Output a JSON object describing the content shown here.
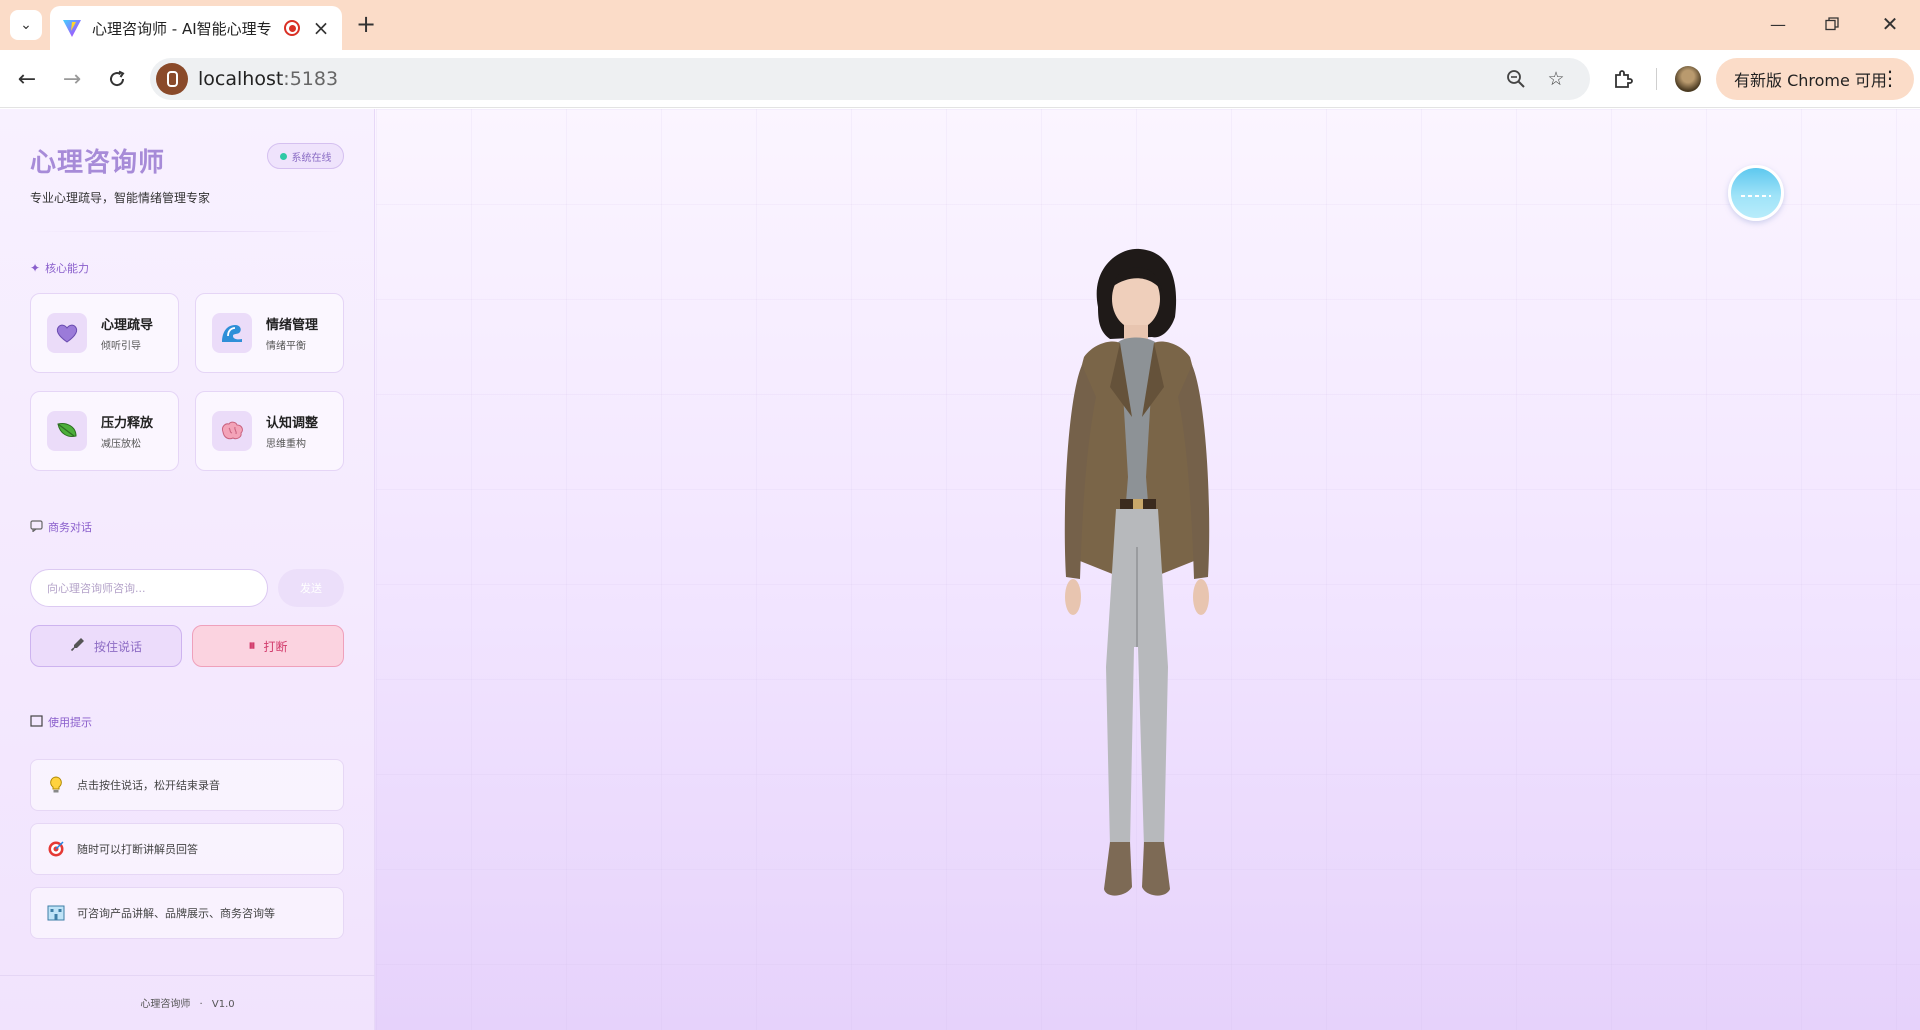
{
  "browser": {
    "tab_title": "心理咨询师 - AI智能心理专",
    "url_host": "localhost",
    "url_port": ":5183",
    "update_label": "有新版 Chrome 可用"
  },
  "sidebar": {
    "title": "心理咨询师",
    "status": "系统在线",
    "subtitle": "专业心理疏导，智能情绪管理专家",
    "capabilities_heading": "核心能力",
    "capabilities": [
      {
        "name": "心理疏导",
        "desc": "倾听引导",
        "icon": "heart-icon"
      },
      {
        "name": "情绪管理",
        "desc": "情绪平衡",
        "icon": "wave-icon"
      },
      {
        "name": "压力释放",
        "desc": "减压放松",
        "icon": "leaf-icon"
      },
      {
        "name": "认知调整",
        "desc": "思维重构",
        "icon": "brain-icon"
      }
    ],
    "dialog_heading": "商务对话",
    "input_placeholder": "向心理咨询师咨询...",
    "send_label": "发送",
    "talk_label": "按住说话",
    "stop_label": "打断",
    "tips_heading": "使用提示",
    "tips": [
      {
        "text": "点击按住说话，松开结束录音",
        "icon": "lightbulb-icon"
      },
      {
        "text": "随时可以打断讲解员回答",
        "icon": "target-icon"
      },
      {
        "text": "可咨询产品讲解、品牌展示、商务咨询等",
        "icon": "building-icon"
      }
    ],
    "footer_name": "心理咨询师",
    "footer_sep": "·",
    "footer_version": "V1.0"
  },
  "colors": {
    "accent": "#a78bd8",
    "status_dot": "#2fc9a6",
    "stop": "#d23b6c"
  }
}
